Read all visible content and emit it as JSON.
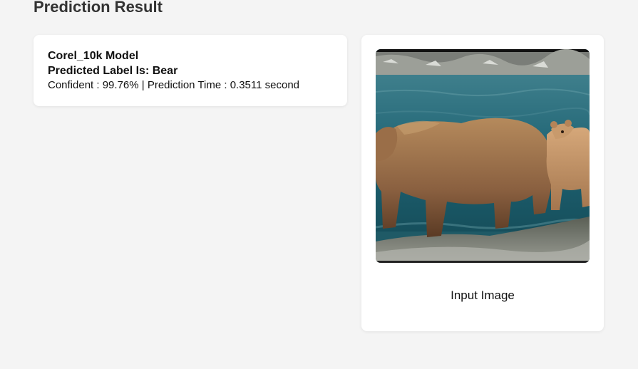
{
  "page": {
    "title": "Prediction Result"
  },
  "result": {
    "model_name": "Corel_10k Model",
    "predicted_label_text": "Predicted Label Is: Bear",
    "stats_text": "Confident : 99.76% | Prediction Time : 0.3511 second"
  },
  "input_image": {
    "caption": "Input Image",
    "subject": "bear-photo"
  }
}
